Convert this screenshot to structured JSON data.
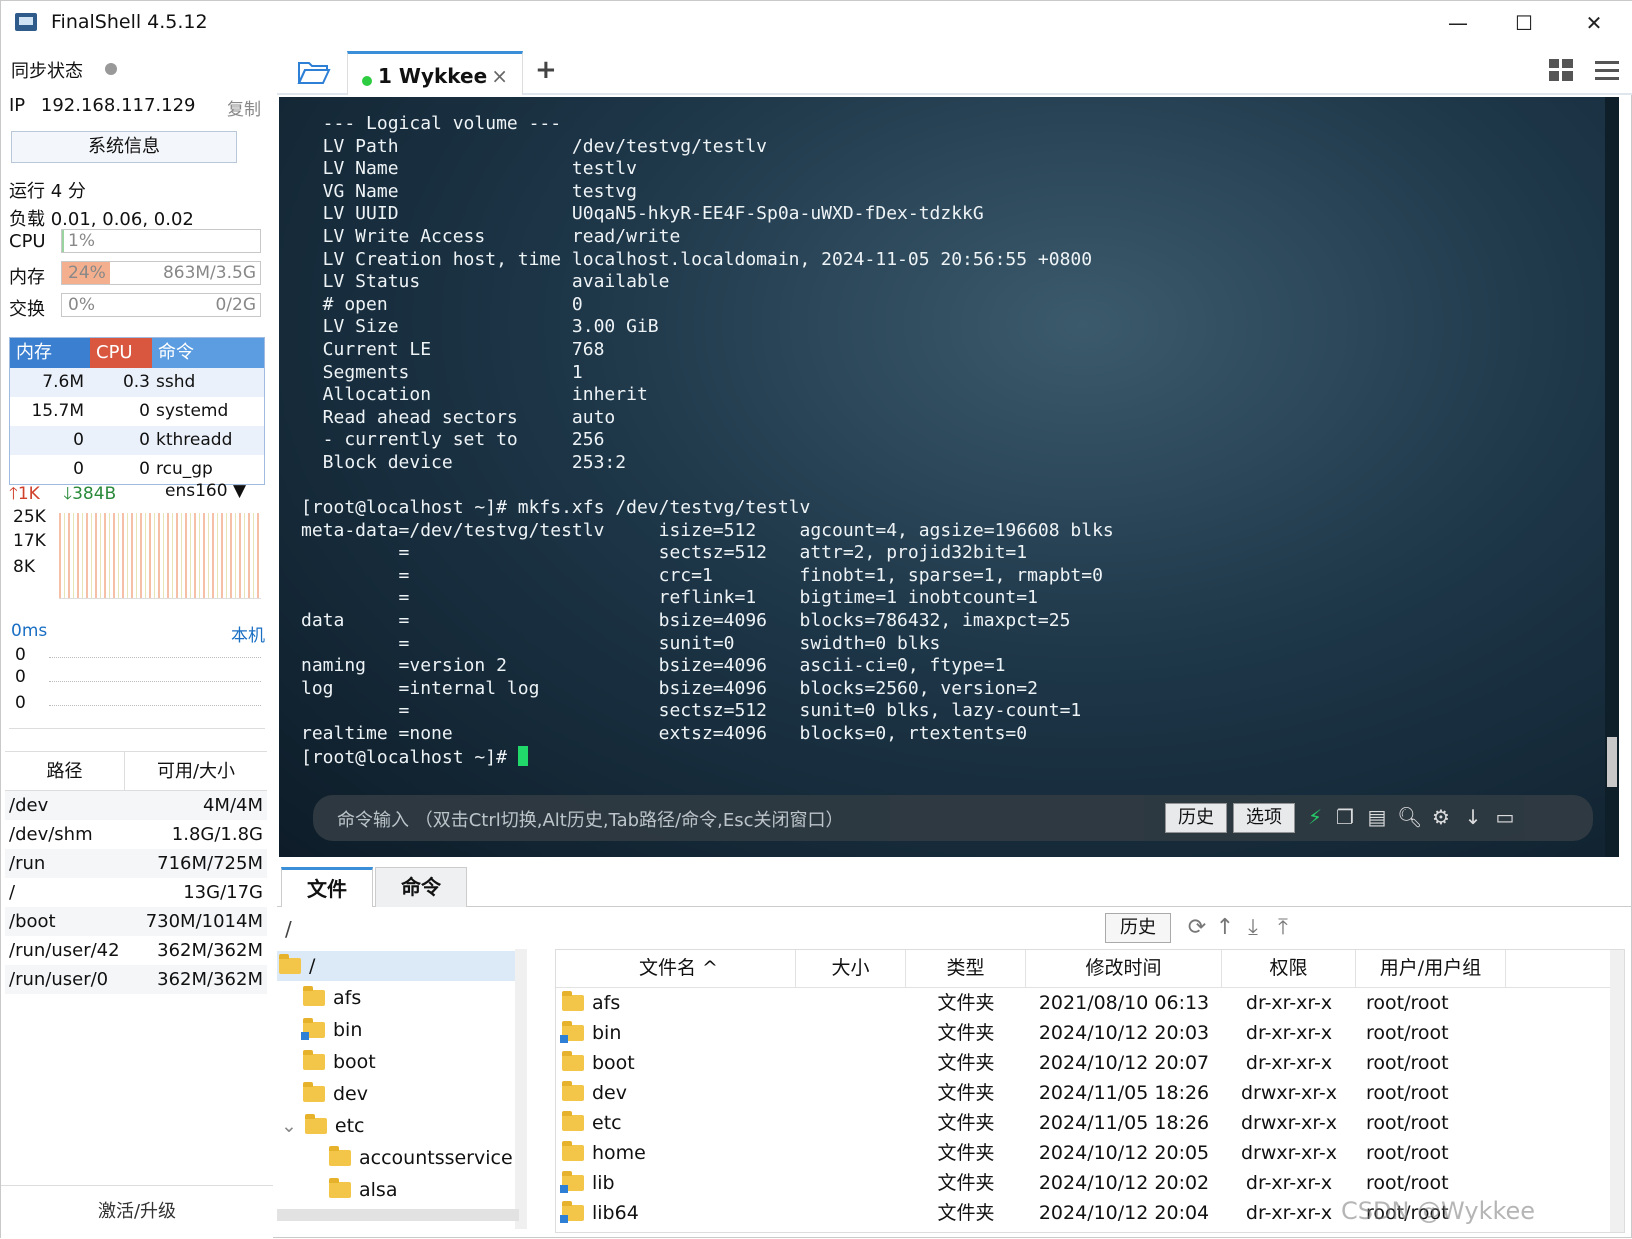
{
  "title": "FinalShell 4.5.12",
  "window_controls": {
    "minimize": "—",
    "maximize": "☐",
    "close": "✕"
  },
  "left": {
    "sync_label": "同步状态",
    "ip_label": "IP",
    "ip": "192.168.117.129",
    "copy": "复制",
    "sysinfo": "系统信息",
    "uptime": "运行 4 分",
    "load": "负载 0.01, 0.06, 0.02",
    "cpu": {
      "label": "CPU",
      "value": "1%",
      "fraction": 0.01
    },
    "mem": {
      "label": "内存",
      "value": "24%",
      "detail": "863M/3.5G",
      "fraction": 0.24
    },
    "swap": {
      "label": "交换",
      "value": "0%",
      "detail": "0/2G",
      "fraction": 0
    },
    "proc_headers": [
      "内存",
      "CPU",
      "命令"
    ],
    "processes": [
      {
        "mem": "7.6M",
        "cpu": "0.3",
        "cmd": "sshd"
      },
      {
        "mem": "15.7M",
        "cpu": "0",
        "cmd": "systemd"
      },
      {
        "mem": "0",
        "cpu": "0",
        "cmd": "kthreadd"
      },
      {
        "mem": "0",
        "cpu": "0",
        "cmd": "rcu_gp"
      }
    ],
    "net_up": "1K",
    "net_down": "384B",
    "net_iface": "ens160",
    "net_scale": [
      "25K",
      "17K",
      "8K"
    ],
    "ping_label": "0ms",
    "ping_target": "本机",
    "ping_scale": [
      "0",
      "0",
      "0"
    ],
    "disk_headers": [
      "路径",
      "可用/大小"
    ],
    "disks": [
      {
        "path": "/dev",
        "size": "4M/4M"
      },
      {
        "path": "/dev/shm",
        "size": "1.8G/1.8G"
      },
      {
        "path": "/run",
        "size": "716M/725M"
      },
      {
        "path": "/",
        "size": "13G/17G"
      },
      {
        "path": "/boot",
        "size": "730M/1014M"
      },
      {
        "path": "/run/user/42",
        "size": "362M/362M"
      },
      {
        "path": "/run/user/0",
        "size": "362M/362M"
      }
    ],
    "activate": "激活/升级"
  },
  "tabs": {
    "session_label": "1 Wykkee",
    "close": "×",
    "add": "+"
  },
  "terminal": {
    "lines": [
      "  --- Logical volume ---",
      "  LV Path                /dev/testvg/testlv",
      "  LV Name                testlv",
      "  VG Name                testvg",
      "  LV UUID                U0qaN5-hkyR-EE4F-Sp0a-uWXD-fDex-tdzkkG",
      "  LV Write Access        read/write",
      "  LV Creation host, time localhost.localdomain, 2024-11-05 20:56:55 +0800",
      "  LV Status              available",
      "  # open                 0",
      "  LV Size                3.00 GiB",
      "  Current LE             768",
      "  Segments               1",
      "  Allocation             inherit",
      "  Read ahead sectors     auto",
      "  - currently set to     256",
      "  Block device           253:2",
      "",
      "[root@localhost ~]# mkfs.xfs /dev/testvg/testlv",
      "meta-data=/dev/testvg/testlv     isize=512    agcount=4, agsize=196608 blks",
      "         =                       sectsz=512   attr=2, projid32bit=1",
      "         =                       crc=1        finobt=1, sparse=1, rmapbt=0",
      "         =                       reflink=1    bigtime=1 inobtcount=1",
      "data     =                       bsize=4096   blocks=786432, imaxpct=25",
      "         =                       sunit=0      swidth=0 blks",
      "naming   =version 2              bsize=4096   ascii-ci=0, ftype=1",
      "log      =internal log           bsize=4096   blocks=2560, version=2",
      "         =                       sectsz=512   sunit=0 blks, lazy-count=1",
      "realtime =none                   extsz=4096   blocks=0, rtextents=0"
    ],
    "prompt": "[root@localhost ~]# "
  },
  "cmdbar": {
    "placeholder": "命令输入 （双击Ctrl切换,Alt历史,Tab路径/命令,Esc关闭窗口）",
    "history": "历史",
    "options": "选项"
  },
  "bottom_tabs": [
    "文件",
    "命令"
  ],
  "path": {
    "current": "/",
    "history": "历史"
  },
  "tree": {
    "root": "/",
    "items": [
      "afs",
      "bin",
      "boot",
      "dev",
      "etc",
      "accountsservice",
      "alsa"
    ]
  },
  "files": {
    "headers": [
      "文件名 ^",
      "大小",
      "类型",
      "修改时间",
      "权限",
      "用户/用户组"
    ],
    "rows": [
      {
        "name": "afs",
        "type": "文件夹",
        "time": "2021/08/10 06:13",
        "perm": "dr-xr-xr-x",
        "owner": "root/root",
        "link": false
      },
      {
        "name": "bin",
        "type": "文件夹",
        "time": "2024/10/12 20:03",
        "perm": "dr-xr-xr-x",
        "owner": "root/root",
        "link": true
      },
      {
        "name": "boot",
        "type": "文件夹",
        "time": "2024/10/12 20:07",
        "perm": "dr-xr-xr-x",
        "owner": "root/root",
        "link": false
      },
      {
        "name": "dev",
        "type": "文件夹",
        "time": "2024/11/05 18:26",
        "perm": "drwxr-xr-x",
        "owner": "root/root",
        "link": false
      },
      {
        "name": "etc",
        "type": "文件夹",
        "time": "2024/11/05 18:26",
        "perm": "drwxr-xr-x",
        "owner": "root/root",
        "link": false
      },
      {
        "name": "home",
        "type": "文件夹",
        "time": "2024/10/12 20:05",
        "perm": "drwxr-xr-x",
        "owner": "root/root",
        "link": false
      },
      {
        "name": "lib",
        "type": "文件夹",
        "time": "2024/10/12 20:02",
        "perm": "dr-xr-xr-x",
        "owner": "root/root",
        "link": true
      },
      {
        "name": "lib64",
        "type": "文件夹",
        "time": "2024/10/12 20:04",
        "perm": "dr-xr-xr-x",
        "owner": "root/root",
        "link": true
      }
    ]
  },
  "watermark": "CSDN @Wykkee",
  "colors": {
    "accent": "#3b8fd9",
    "mem_fill": "#f4b08e",
    "cpu_head": "#d9573f",
    "mem_head": "#3b7fd0",
    "cmd_head": "#5b9de0"
  }
}
